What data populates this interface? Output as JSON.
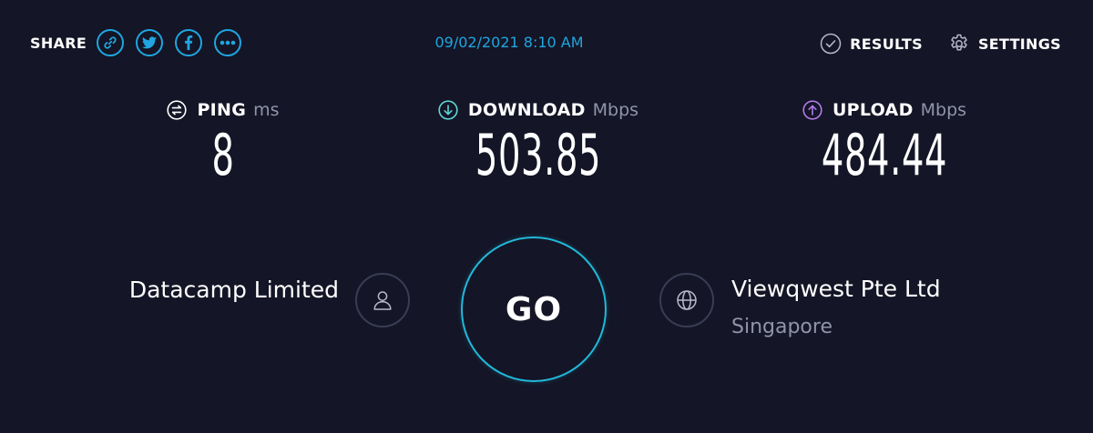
{
  "header": {
    "share_label": "SHARE",
    "share_buttons": [
      {
        "icon": "link-icon"
      },
      {
        "icon": "twitter-icon"
      },
      {
        "icon": "facebook-icon"
      },
      {
        "icon": "more-icon"
      }
    ],
    "datetime": "09/02/2021 8:10 AM",
    "results_label": "RESULTS",
    "settings_label": "SETTINGS"
  },
  "metrics": {
    "ping": {
      "label": "PING",
      "unit": "ms",
      "value": "8",
      "icon": "ping-icon"
    },
    "download": {
      "label": "DOWNLOAD",
      "unit": "Mbps",
      "value": "503.85",
      "icon": "download-arrow-icon"
    },
    "upload": {
      "label": "UPLOAD",
      "unit": "Mbps",
      "value": "484.44",
      "icon": "upload-arrow-icon"
    }
  },
  "connection": {
    "isp_name": "Datacamp Limited",
    "go_label": "GO",
    "server_name": "Viewqwest Pte Ltd",
    "server_location": "Singapore"
  },
  "colors": {
    "background": "#141526",
    "accent_blue": "#1fa6e0",
    "download_accent": "#5dd6d6",
    "upload_accent": "#b07be8",
    "muted_text": "#9193a8",
    "go_ring": "#21b8d9"
  }
}
